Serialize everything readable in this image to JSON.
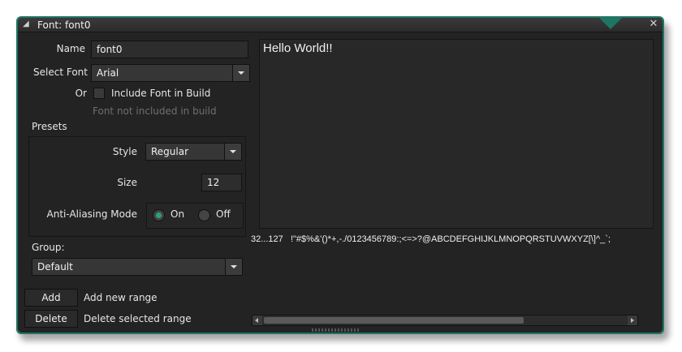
{
  "window": {
    "title": "Font: font0",
    "close_glyph": "✕"
  },
  "form": {
    "name_label": "Name",
    "name_value": "font0",
    "select_font_label": "Select Font",
    "select_font_value": "Arial",
    "or_label": "Or",
    "include_label": "Include Font in Build",
    "include_checked": false,
    "not_included_text": "Font not included in build"
  },
  "presets": {
    "title": "Presets",
    "style_label": "Style",
    "style_value": "Regular",
    "size_label": "Size",
    "size_value": "12",
    "aa_label": "Anti-Aliasing Mode",
    "aa_on": "On",
    "aa_off": "Off",
    "aa_selected": "On"
  },
  "group": {
    "label": "Group:",
    "value": "Default"
  },
  "actions": {
    "add_label": "Add",
    "add_desc": "Add new range",
    "delete_label": "Delete",
    "delete_desc": "Delete selected range"
  },
  "preview": {
    "text": "Hello World!!"
  },
  "range": {
    "span": "32...127",
    "chars": "!\"#$%&'()*+,-./0123456789:;<=>?@ABCDEFGHIJKLMNOPQRSTUVWXYZ[\\]^_`;"
  },
  "colors": {
    "accent": "#1f7563",
    "radio_on": "#2aa274"
  }
}
